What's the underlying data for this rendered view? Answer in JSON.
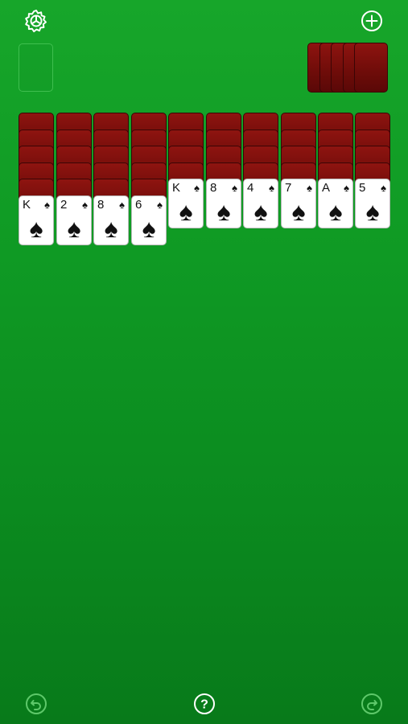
{
  "toolbar": {
    "settings_icon": "settings-gear-icon",
    "new_game_icon": "plus-circle-icon"
  },
  "bottom_bar": {
    "undo_icon": "undo-icon",
    "help_icon": "help-icon",
    "help_label": "?",
    "redo_icon": "redo-icon"
  },
  "stock": {
    "remaining_deals": 5
  },
  "tableau": [
    {
      "face_down": 5,
      "top": {
        "rank": "K",
        "suit": "♠"
      }
    },
    {
      "face_down": 5,
      "top": {
        "rank": "2",
        "suit": "♠"
      }
    },
    {
      "face_down": 5,
      "top": {
        "rank": "8",
        "suit": "♠"
      }
    },
    {
      "face_down": 5,
      "top": {
        "rank": "6",
        "suit": "♠"
      }
    },
    {
      "face_down": 4,
      "top": {
        "rank": "K",
        "suit": "♠"
      }
    },
    {
      "face_down": 4,
      "top": {
        "rank": "8",
        "suit": "♠"
      }
    },
    {
      "face_down": 4,
      "top": {
        "rank": "4",
        "suit": "♠"
      }
    },
    {
      "face_down": 4,
      "top": {
        "rank": "7",
        "suit": "♠"
      }
    },
    {
      "face_down": 4,
      "top": {
        "rank": "A",
        "suit": "♠"
      }
    },
    {
      "face_down": 4,
      "top": {
        "rank": "5",
        "suit": "♠"
      }
    }
  ]
}
